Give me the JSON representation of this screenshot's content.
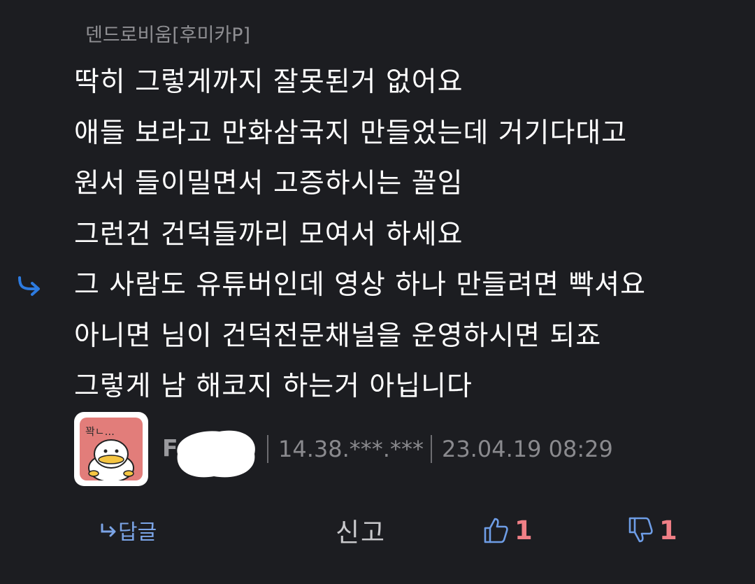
{
  "comment": {
    "mention": "덴드로비움[후미카P]",
    "lines": [
      "딱히 그렇게까지 잘못된거 없어요",
      "애들 보라고 만화삼국지 만들었는데 거기다대고",
      "원서 들이밀면서 고증하시는 꼴임",
      "그런건 건덕들까리 모여서 하세요",
      "그 사람도 유튜버인데 영상 하나 만들려면 빡셔요",
      "아니면 님이 건덕전문채널을 운영하시면 되죠",
      "그렇게 남 해코지 하는거 아닙니다"
    ]
  },
  "meta": {
    "author_initial": "F",
    "ip": "14.38.***.***",
    "timestamp": "23.04.19 08:29",
    "avatar_text": "꽉ㄴ..."
  },
  "actions": {
    "reply_label": "답글",
    "report_label": "신고",
    "like_count": "1",
    "dislike_count": "1"
  },
  "colors": {
    "background": "#1c1d21",
    "accent_blue": "#2d7be0",
    "count_pink": "#f07f86",
    "avatar_bg": "#e27d7a"
  },
  "icons": {
    "reply_indicator": "reply-arrow-icon",
    "reply_action": "reply-arrow-icon",
    "like": "thumbs-up-icon",
    "dislike": "thumbs-down-icon"
  }
}
